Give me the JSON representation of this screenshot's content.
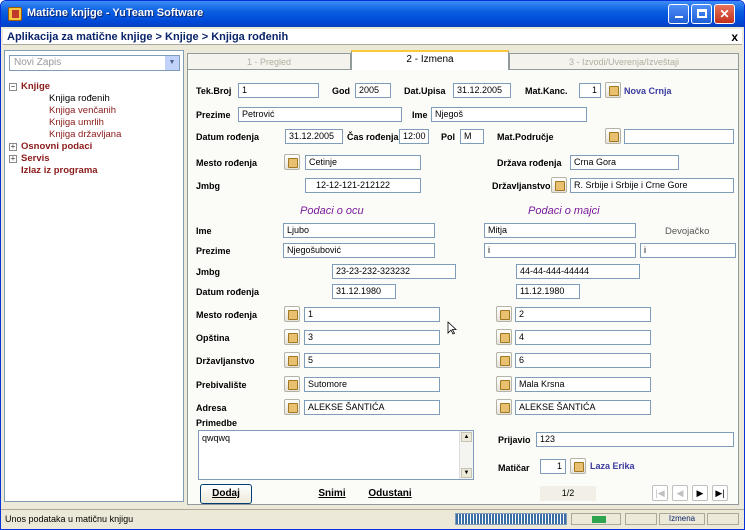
{
  "window": {
    "title": "Matične knjige - YuTeam Software"
  },
  "breadcrumb": {
    "text": "Aplikacija za matične knjige > Knjige > Knjiga rođenih",
    "close": "x"
  },
  "left": {
    "combo": "Novi Zapis",
    "tree": [
      {
        "label": "Knjige",
        "level": 0,
        "expand": "−"
      },
      {
        "label": "Knjiga rođenih",
        "level": 1,
        "selected": true
      },
      {
        "label": "Knjiga venčanih",
        "level": 1
      },
      {
        "label": "Knjiga umrlih",
        "level": 1
      },
      {
        "label": "Knjiga državljana",
        "level": 1
      },
      {
        "label": "Osnovni podaci",
        "level": 0,
        "expand": "+"
      },
      {
        "label": "Servis",
        "level": 0,
        "expand": "+"
      },
      {
        "label": "Izlaz iz programa",
        "level": 0
      }
    ]
  },
  "tabs": [
    {
      "label": "1 - Pregled",
      "active": false
    },
    {
      "label": "2 - Izmena",
      "active": true
    },
    {
      "label": "3 - Izvodi/Uverenja/Izveštaji",
      "active": false
    }
  ],
  "form": {
    "tekbroj": {
      "label": "Tek.Broj",
      "value": "1"
    },
    "god": {
      "label": "God",
      "value": "2005"
    },
    "datupisa": {
      "label": "Dat.Upisa",
      "value": "31.12.2005"
    },
    "matkanc": {
      "label": "Mat.Kanc.",
      "value": "1",
      "text": "Nova Crnja"
    },
    "prezime": {
      "label": "Prezime",
      "value": "Petrović"
    },
    "ime": {
      "label": "Ime",
      "value": "Njegoš"
    },
    "datumrodj": {
      "label": "Datum rođenja",
      "value": "31.12.2005"
    },
    "casrodj": {
      "label": "Čas rođenja",
      "value": "12:00"
    },
    "pol": {
      "label": "Pol",
      "value": "M"
    },
    "matpodr": {
      "label": "Mat.Područje",
      "value": ""
    },
    "mestorodj": {
      "label": "Mesto rođenja",
      "value": "Cetinje"
    },
    "drzavarodj": {
      "label": "Država rođenja",
      "value": "Crna Gora"
    },
    "jmbg": {
      "label": "Jmbg",
      "value": "12-12-121-212122"
    },
    "drzavljanstvo": {
      "label": "Državljanstvo",
      "value": "R. Srbije i Srbije i Crne Gore"
    },
    "otac_title": "Podaci o ocu",
    "majka_title": "Podaci o majci",
    "devojacko": "Devojačko",
    "labels": {
      "ime": "Ime",
      "prezime": "Prezime",
      "jmbg": "Jmbg",
      "datum": "Datum rođenja",
      "mesto": "Mesto rođenja",
      "opstina": "Opština",
      "drzavljanstvo": "Državljanstvo",
      "prebivaliste": "Prebivalište",
      "adresa": "Adresa"
    },
    "otac": {
      "ime": "Ljubo",
      "prezime": "Njegošubović",
      "jmbg": "23-23-232-323232",
      "datum": "31.12.1980",
      "mesto": "1",
      "opstina": "3",
      "drzavljanstvo": "5",
      "prebivaliste": "Sutomore",
      "adresa": "ALEKSE ŠANTIĆA"
    },
    "majka": {
      "ime": "Mitja",
      "prezime": "i",
      "devojacko": "i",
      "jmbg": "44-44-444-44444",
      "datum": "11.12.1980",
      "mesto": "2",
      "opstina": "4",
      "drzavljanstvo": "6",
      "prebivaliste": "Mala Krsna",
      "adresa": "ALEKSE ŠANTIĆA"
    },
    "primedbe": {
      "label": "Primedbe",
      "value": "qwqwq"
    },
    "prijavio": {
      "label": "Prijavio",
      "value": "123"
    },
    "maticar": {
      "label": "Matičar",
      "value": "1",
      "text": "Laza Erika"
    }
  },
  "buttons": {
    "dodaj": "Dodaj",
    "snimi": "Snimi",
    "odustani": "Odustani"
  },
  "navigator": {
    "counter": "1/2",
    "first": "|◀",
    "prev": "◀",
    "next": "▶",
    "last": "▶|"
  },
  "status": {
    "message": "Unos podataka u matičnu knjigu",
    "cell": "Izmena"
  },
  "colors": {
    "title_bar": "#0054e3",
    "section_title": "#7a1a9a",
    "tree_text": "#8b1a1a"
  }
}
